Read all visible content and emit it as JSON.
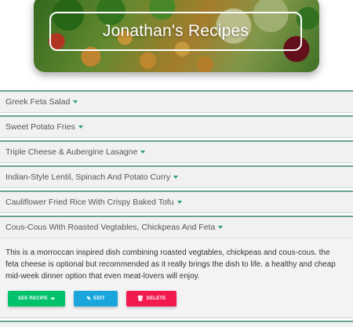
{
  "header": {
    "title": "Jonathan's Recipes"
  },
  "recipes": [
    {
      "name": "Greek Feta Salad"
    },
    {
      "name": "Sweet Potato Fries"
    },
    {
      "name": "Triple Cheese & Aubergine Lasagne"
    },
    {
      "name": "Indian-Style Lentil, Spinach And Potato Curry"
    },
    {
      "name": "Cauliflower Fried Rice With Crispy Baked Tofu"
    },
    {
      "name": "Cous-Cous With Roasted Vegtables, Chickpeas And Feta",
      "description": "This is a morroccan inspired dish combining roasted vegtables, chickpeas and cous-cous. the feta cheese is optional but recommended as it really brings the dish to life. a healthy and cheap mid-week dinner option that even meat-lovers will enjoy."
    }
  ],
  "actions": {
    "see_recipe": "See Recipe",
    "edit": "Edit",
    "delete": "Delete"
  },
  "icons": {
    "caret": "caret-down-icon",
    "see_recipe": "arrow-right-icon",
    "edit": "edit-icon",
    "delete": "trash-icon"
  },
  "colors": {
    "accent_green": "#00c26a",
    "edit_blue": "#1aa6dc",
    "delete_red": "#f2194e",
    "divider": "#6aa58a",
    "caret": "#2d9e6b"
  }
}
